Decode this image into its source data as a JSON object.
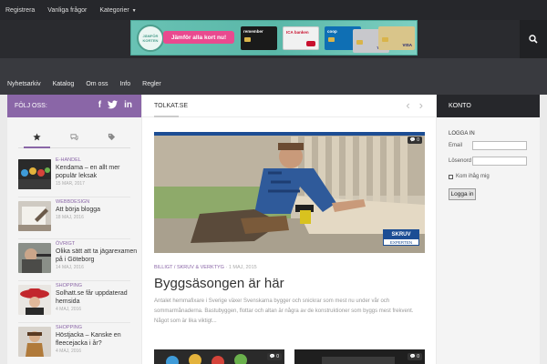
{
  "topbar": {
    "links": [
      "Registrera",
      "Vanliga frågor",
      "Kategorier"
    ],
    "caret_icon": "chevron-down-icon"
  },
  "banner": {
    "seal_text": "JÄMFÖR KORTEN",
    "cta_label": "Jämför alla kort nu!",
    "cards": [
      "remember",
      "ICA banken",
      "coop",
      "VISA",
      "VISA"
    ]
  },
  "nav": {
    "items": [
      "Nyhetsarkiv",
      "Katalog",
      "Om oss",
      "Info",
      "Regler"
    ]
  },
  "follow": {
    "label": "FÖLJ OSS:",
    "icons": [
      "facebook-icon",
      "twitter-icon",
      "linkedin-icon"
    ],
    "glyphs": [
      "f",
      "t",
      "in"
    ]
  },
  "sidebar_tabs": {
    "icons": [
      "star-icon",
      "comments-icon",
      "tags-icon"
    ]
  },
  "posts": [
    {
      "category": "E-HANDEL",
      "title": "Kendama – en allt mer populär leksak",
      "date": "15 MAR, 2017"
    },
    {
      "category": "WEBBDESIGN",
      "title": "Att börja blogga",
      "date": "18 MAJ, 2016"
    },
    {
      "category": "ÖVRIGT",
      "title": "Olika sätt att ta jägarexamen på i Göteborg",
      "date": "14 MAJ, 2016"
    },
    {
      "category": "SHOPPING",
      "title": "Solhatt.se får uppdaterad hemsida",
      "date": "4 MAJ, 2016"
    },
    {
      "category": "SHOPPING",
      "title": "Höstjacka – Kanske en fleecejacka i år?",
      "date": "4 MAJ, 2016"
    }
  ],
  "center": {
    "title": "TOLKAT.SE",
    "featured": {
      "comment_count": "0",
      "logo_line1": "SKRUV",
      "logo_line2": "EXPERTEN",
      "categories": "BILLIGT / SKRUV & VERKTYG",
      "date": "1 MAJ, 2015",
      "title": "Byggsäsongen är här",
      "excerpt": "Antalet hemmafixare i Sverige växer Svenskarna bygger och snickrar som mest nu under vår och sommarmånaderna. Bastubyggen, flottar och altan är några av de konstruktioner som byggs mest frekvent. Något som är lika viktigt..."
    },
    "more_comment_counts": [
      "0",
      "0"
    ]
  },
  "account": {
    "header": "KONTO",
    "login_title": "LOGGA IN",
    "email_label": "Email",
    "password_label": "Lösenord",
    "remember_label": "Kom ihåg mig",
    "button_label": "Logga in"
  },
  "colors": {
    "accent": "#8a66a7",
    "dark": "#26272b",
    "nav": "#393a3f",
    "banner": "#69c2b4",
    "cta": "#e94a8f"
  }
}
